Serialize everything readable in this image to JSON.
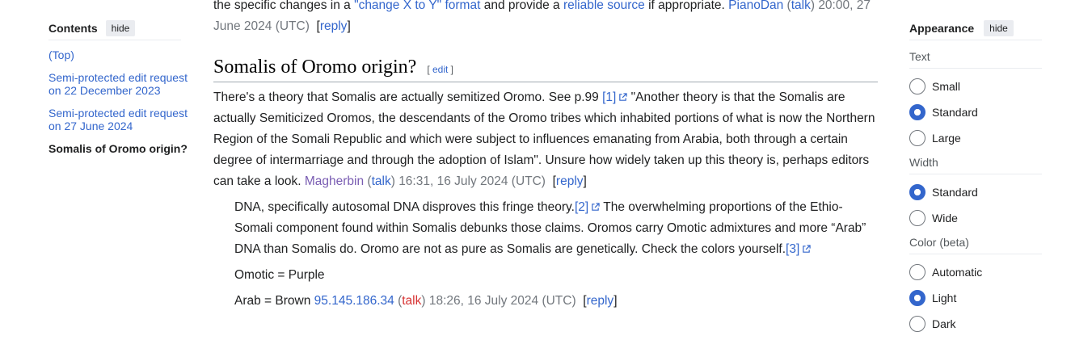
{
  "toc": {
    "title": "Contents",
    "hide_label": "hide",
    "items": [
      {
        "label": "(Top)"
      },
      {
        "label": "Semi-protected edit request on 22 December 2023"
      },
      {
        "label": "Semi-protected edit request on 27 June 2024"
      },
      {
        "label": "Somalis of Oromo origin?"
      }
    ]
  },
  "prev": {
    "t1": "the specific changes in a ",
    "link1": "\"change X to Y\" format",
    "t2": " and provide a ",
    "link2": "reliable source",
    "t3": " if appropriate. ",
    "user": "PianoDan",
    "talk_open": " (",
    "talk": "talk",
    "talk_close": ") ",
    "time": "20:00, 27 June 2024 (UTC)",
    "reply_open": "[",
    "reply": "reply",
    "reply_close": "]"
  },
  "section": {
    "heading": "Somalis of Oromo origin?",
    "edit_open": "[ ",
    "edit": "edit",
    "edit_close": " ]"
  },
  "post1": {
    "t1": "There's a theory that Somalis are actually semitized Oromo. See p.99 ",
    "ref": "[1]",
    "t2": " \"Another theory is that the Somalis are actually Semiticized Oromos, the descendants of the Oromo tribes which inhabited portions of what is now the Northern Region of the Somali Republic and which were subject to influences emanating from Arabia, both through a certain degree of intermarriage and through the adoption of Islam\". Unsure how widely taken up this theory is, perhaps editors can take a look. ",
    "user": "Magherbin",
    "talk_open": " (",
    "talk": "talk",
    "talk_close": ") ",
    "time": "16:31, 16 July 2024 (UTC)",
    "reply_open": "[",
    "reply": "reply",
    "reply_close": "]"
  },
  "post2": {
    "t1": "DNA, specifically autosomal DNA disproves this fringe theory.",
    "ref2": "[2]",
    "t2": " The overwhelming proportions of the Ethio-Somali component found within Somalis debunks those claims. Oromos carry Omotic admixtures and more “Arab” DNA than Somalis do. Oromo are not as pure as Somalis are genetically. Check the colors yourself.",
    "ref3": "[3]",
    "line2": "Omotic = Purple",
    "line3": "Arab = Brown ",
    "user": "95.145.186.34",
    "talk_open": " (",
    "talk": "talk",
    "talk_close": ") ",
    "time": "18:26, 16 July 2024 (UTC)",
    "reply_open": "[",
    "reply": "reply",
    "reply_close": "]"
  },
  "appearance": {
    "title": "Appearance",
    "hide_label": "hide",
    "text_label": "Text",
    "text_options": [
      {
        "label": "Small",
        "checked": false
      },
      {
        "label": "Standard",
        "checked": true
      },
      {
        "label": "Large",
        "checked": false
      }
    ],
    "width_label": "Width",
    "width_options": [
      {
        "label": "Standard",
        "checked": true
      },
      {
        "label": "Wide",
        "checked": false
      }
    ],
    "color_label": "Color (beta)",
    "color_options": [
      {
        "label": "Automatic",
        "checked": false
      },
      {
        "label": "Light",
        "checked": true
      },
      {
        "label": "Dark",
        "checked": false
      }
    ]
  },
  "colors": {
    "link": "#3366cc",
    "visited": "#795cb2",
    "redlink": "#d73333",
    "text": "#202122"
  }
}
